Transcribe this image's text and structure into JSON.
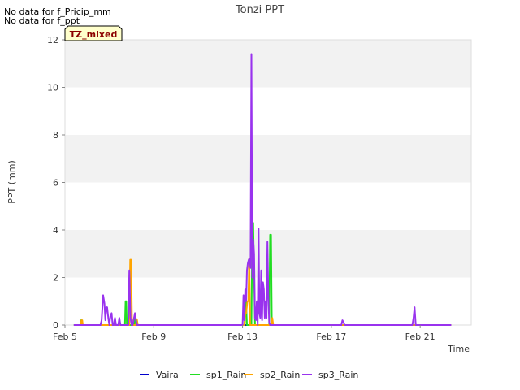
{
  "notes": [
    "No data for f_Pricip_mm",
    "No data for f_ppt"
  ],
  "badge": "TZ_mixed",
  "chart_data": {
    "type": "line",
    "title": "Tonzi PPT",
    "xlabel": "Time",
    "ylabel": "PPT (mm)",
    "xlim": [
      5.0,
      23.3
    ],
    "ylim": [
      0,
      12
    ],
    "x_ticks": [
      5,
      9,
      13,
      17,
      21
    ],
    "x_tick_labels": [
      "Feb 5",
      "Feb 9",
      "Feb 13",
      "Feb 17",
      "Feb 21"
    ],
    "y_ticks": [
      0,
      2,
      4,
      6,
      8,
      10,
      12
    ],
    "grid": "horizontal alternating bands",
    "legend_position": "bottom",
    "series": [
      {
        "name": "Vaira",
        "color": "#0000cc",
        "x": [
          5.4,
          22.4
        ],
        "y": [
          0,
          0
        ]
      },
      {
        "name": "sp1_Rain",
        "color": "#22dd22",
        "x": [
          5.4,
          5.7,
          5.72,
          5.76,
          5.78,
          7.7,
          7.73,
          7.76,
          7.79,
          8.1,
          8.14,
          8.18,
          13.0,
          13.1,
          13.14,
          13.2,
          13.4,
          13.44,
          13.48,
          13.52,
          13.56,
          14.2,
          14.24,
          14.28,
          14.32,
          22.4
        ],
        "y": [
          0,
          0,
          0.2,
          0.2,
          0,
          0,
          1.0,
          1.0,
          0,
          0,
          0.3,
          0,
          0,
          0,
          1.4,
          0,
          0,
          4.3,
          4.3,
          2.0,
          0,
          0,
          3.8,
          3.8,
          0,
          0
        ]
      },
      {
        "name": "sp2_Rain",
        "color": "#ffa500",
        "x": [
          5.4,
          5.72,
          5.74,
          5.78,
          5.8,
          7.9,
          7.94,
          7.98,
          8.02,
          8.2,
          8.24,
          8.28,
          13.0,
          13.08,
          13.12,
          13.16,
          13.22,
          13.26,
          13.3,
          13.34,
          14.3,
          14.34,
          14.38,
          22.4
        ],
        "y": [
          0,
          0,
          0.2,
          0.2,
          0,
          0,
          2.75,
          2.75,
          0,
          0,
          0.25,
          0,
          0,
          0,
          0.5,
          0.5,
          1.0,
          1.0,
          2.8,
          0,
          0,
          0.3,
          0,
          0
        ]
      },
      {
        "name": "sp3_Rain",
        "color": "#9933ee",
        "x": [
          5.4,
          6.6,
          6.65,
          6.72,
          6.78,
          6.82,
          6.86,
          6.9,
          6.95,
          7.0,
          7.05,
          7.1,
          7.15,
          7.2,
          7.25,
          7.3,
          7.4,
          7.45,
          7.5,
          7.55,
          7.6,
          7.65,
          7.7,
          7.75,
          7.8,
          7.85,
          7.9,
          7.95,
          8.0,
          8.05,
          8.1,
          8.15,
          8.2,
          8.25,
          8.3,
          12.9,
          13.0,
          13.04,
          13.08,
          13.12,
          13.16,
          13.2,
          13.24,
          13.28,
          13.32,
          13.36,
          13.4,
          13.44,
          13.48,
          13.52,
          13.56,
          13.6,
          13.64,
          13.68,
          13.72,
          13.76,
          13.8,
          13.84,
          13.88,
          13.92,
          13.96,
          14.0,
          14.04,
          14.08,
          14.12,
          14.16,
          14.2,
          14.24,
          14.28,
          14.32,
          14.36,
          14.4,
          17.45,
          17.5,
          17.55,
          17.6,
          20.6,
          20.65,
          20.7,
          20.75,
          20.8,
          22.4
        ],
        "y": [
          0,
          0,
          0.2,
          1.25,
          0.9,
          0.2,
          0.75,
          0.75,
          0.3,
          0.0,
          0.4,
          0.5,
          0.0,
          0.0,
          0.3,
          0.0,
          0.0,
          0.3,
          0.0,
          0.0,
          0.0,
          0.0,
          0.0,
          0.0,
          0.0,
          0.0,
          2.3,
          0.3,
          0.0,
          0.0,
          0.25,
          0.5,
          0.2,
          0.0,
          0.0,
          0,
          0,
          1.25,
          0.2,
          1.5,
          1.0,
          2.3,
          2.6,
          2.75,
          2.8,
          2.4,
          11.4,
          2.0,
          3.6,
          3.0,
          0.3,
          0.2,
          1.0,
          0.0,
          4.05,
          0.5,
          0.3,
          2.3,
          0.2,
          1.8,
          1.5,
          0.3,
          1.0,
          0.3,
          3.5,
          1.2,
          0.1,
          0.0,
          0.0,
          0.0,
          0.0,
          0.0,
          0,
          0.2,
          0.1,
          0,
          0,
          0,
          0.3,
          0.75,
          0,
          0
        ]
      }
    ]
  }
}
